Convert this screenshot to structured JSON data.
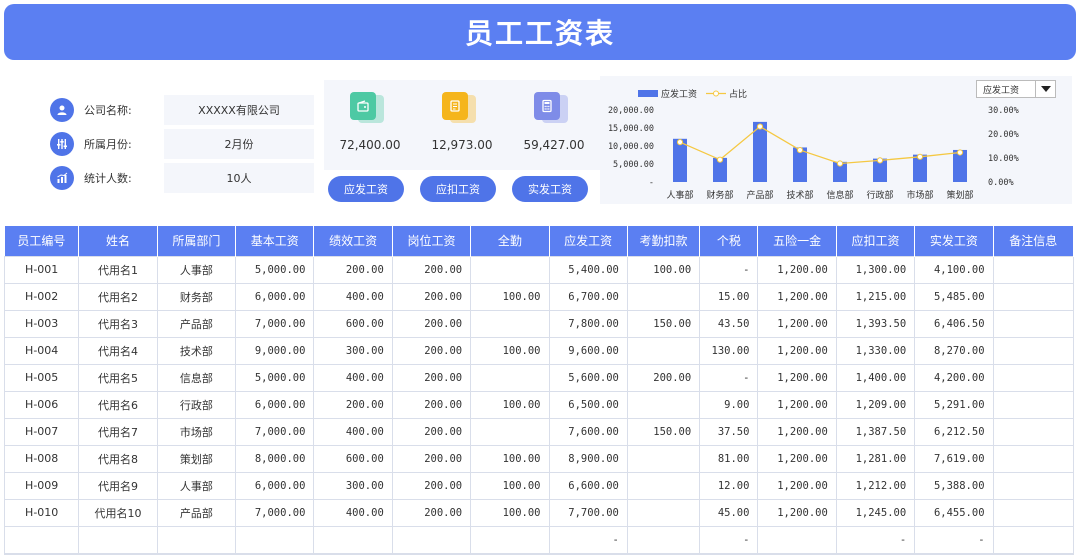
{
  "title": "员工工资表",
  "info": [
    {
      "label": "公司名称:",
      "value": "XXXXX有限公司",
      "icon": "user-icon"
    },
    {
      "label": "所属月份:",
      "value": "2月份",
      "icon": "sliders-icon"
    },
    {
      "label": "统计人数:",
      "value": "10人",
      "icon": "chart-icon"
    }
  ],
  "cards": [
    {
      "value": "72,400.00",
      "button": "应发工资",
      "icon": "wallet-icon",
      "color": "#4dc9a4"
    },
    {
      "value": "12,973.00",
      "button": "应扣工资",
      "icon": "document-icon",
      "color": "#f5b51c"
    },
    {
      "value": "59,427.00",
      "button": "实发工资",
      "icon": "calculator-icon",
      "color": "#7f8ce8"
    }
  ],
  "dropdown": {
    "selected": "应发工资"
  },
  "chart_data": {
    "type": "bar",
    "categories": [
      "人事部",
      "财务部",
      "产品部",
      "技术部",
      "信息部",
      "行政部",
      "市场部",
      "策划部"
    ],
    "series": [
      {
        "name": "应发工资",
        "type": "bar",
        "axis": "left",
        "color": "#4f74e8",
        "values": [
          12000,
          6700,
          16700,
          9600,
          5600,
          6500,
          7600,
          8900
        ]
      },
      {
        "name": "占比",
        "type": "line",
        "axis": "right",
        "color": "#f5c842",
        "values": [
          0.166,
          0.093,
          0.231,
          0.133,
          0.077,
          0.09,
          0.105,
          0.123
        ]
      }
    ],
    "left_ticks": [
      "20,000.00",
      "15,000.00",
      "10,000.00",
      "5,000.00",
      "-"
    ],
    "right_ticks": [
      "30.00%",
      "20.00%",
      "10.00%",
      "0.00%"
    ],
    "ylim": [
      0,
      20000
    ],
    "y2lim": [
      0,
      0.3
    ],
    "legend_position": "top-left"
  },
  "table": {
    "headers": [
      "员工编号",
      "姓名",
      "所属部门",
      "基本工资",
      "绩效工资",
      "岗位工资",
      "全勤",
      "应发工资",
      "考勤扣款",
      "个税",
      "五险一金",
      "应扣工资",
      "实发工资",
      "备注信息"
    ],
    "rows": [
      [
        "H-001",
        "代用名1",
        "人事部",
        "5,000.00",
        "200.00",
        "200.00",
        "",
        "5,400.00",
        "100.00",
        "-",
        "1,200.00",
        "1,300.00",
        "4,100.00",
        ""
      ],
      [
        "H-002",
        "代用名2",
        "财务部",
        "6,000.00",
        "400.00",
        "200.00",
        "100.00",
        "6,700.00",
        "",
        "15.00",
        "1,200.00",
        "1,215.00",
        "5,485.00",
        ""
      ],
      [
        "H-003",
        "代用名3",
        "产品部",
        "7,000.00",
        "600.00",
        "200.00",
        "",
        "7,800.00",
        "150.00",
        "43.50",
        "1,200.00",
        "1,393.50",
        "6,406.50",
        ""
      ],
      [
        "H-004",
        "代用名4",
        "技术部",
        "9,000.00",
        "300.00",
        "200.00",
        "100.00",
        "9,600.00",
        "",
        "130.00",
        "1,200.00",
        "1,330.00",
        "8,270.00",
        ""
      ],
      [
        "H-005",
        "代用名5",
        "信息部",
        "5,000.00",
        "400.00",
        "200.00",
        "",
        "5,600.00",
        "200.00",
        "-",
        "1,200.00",
        "1,400.00",
        "4,200.00",
        ""
      ],
      [
        "H-006",
        "代用名6",
        "行政部",
        "6,000.00",
        "200.00",
        "200.00",
        "100.00",
        "6,500.00",
        "",
        "9.00",
        "1,200.00",
        "1,209.00",
        "5,291.00",
        ""
      ],
      [
        "H-007",
        "代用名7",
        "市场部",
        "7,000.00",
        "400.00",
        "200.00",
        "",
        "7,600.00",
        "150.00",
        "37.50",
        "1,200.00",
        "1,387.50",
        "6,212.50",
        ""
      ],
      [
        "H-008",
        "代用名8",
        "策划部",
        "8,000.00",
        "600.00",
        "200.00",
        "100.00",
        "8,900.00",
        "",
        "81.00",
        "1,200.00",
        "1,281.00",
        "7,619.00",
        ""
      ],
      [
        "H-009",
        "代用名9",
        "人事部",
        "6,000.00",
        "300.00",
        "200.00",
        "100.00",
        "6,600.00",
        "",
        "12.00",
        "1,200.00",
        "1,212.00",
        "5,388.00",
        ""
      ],
      [
        "H-010",
        "代用名10",
        "产品部",
        "7,000.00",
        "400.00",
        "200.00",
        "100.00",
        "7,700.00",
        "",
        "45.00",
        "1,200.00",
        "1,245.00",
        "6,455.00",
        ""
      ],
      [
        "",
        "",
        "",
        "",
        "",
        "",
        "",
        "-",
        "",
        "-",
        "",
        "-",
        "-",
        ""
      ]
    ]
  }
}
